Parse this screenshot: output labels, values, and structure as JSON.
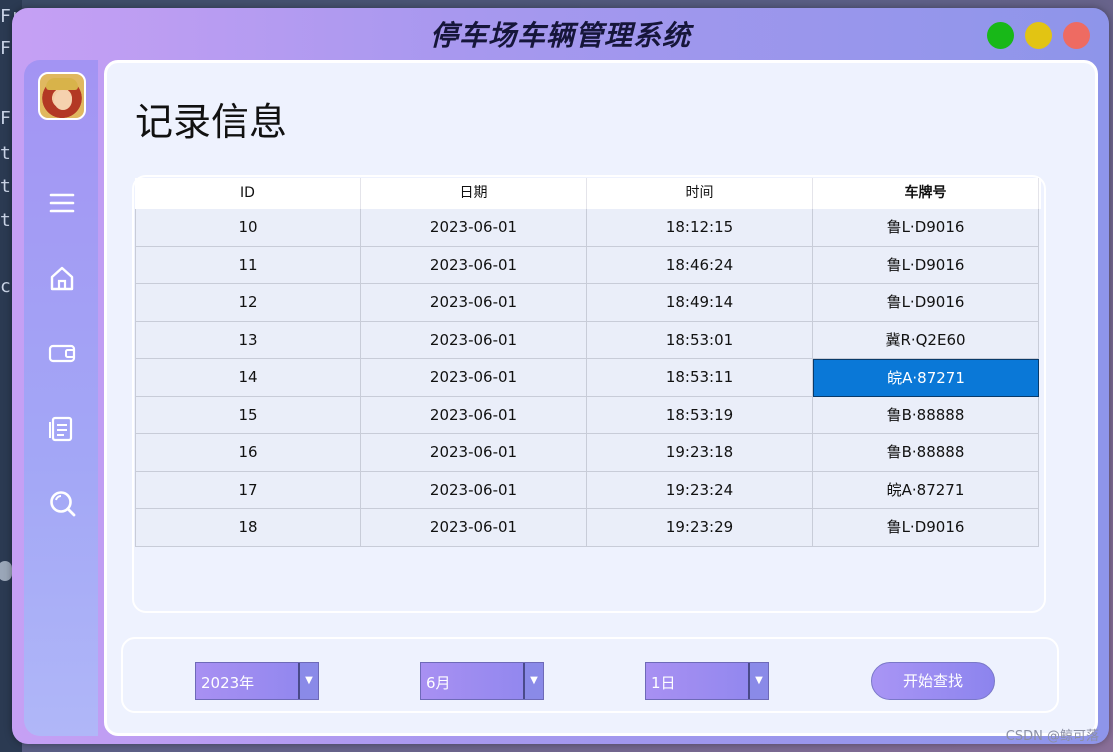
{
  "window": {
    "title": "停车场车辆管理系统"
  },
  "page": {
    "title": "记录信息"
  },
  "table": {
    "columns": [
      "ID",
      "日期",
      "时间",
      "车牌号"
    ],
    "rows": [
      [
        "10",
        "2023-06-01",
        "18:12:15",
        "鲁L·D9016"
      ],
      [
        "11",
        "2023-06-01",
        "18:46:24",
        "鲁L·D9016"
      ],
      [
        "12",
        "2023-06-01",
        "18:49:14",
        "鲁L·D9016"
      ],
      [
        "13",
        "2023-06-01",
        "18:53:01",
        "冀R·Q2E60"
      ],
      [
        "14",
        "2023-06-01",
        "18:53:11",
        "皖A·87271"
      ],
      [
        "15",
        "2023-06-01",
        "18:53:19",
        "鲁B·88888"
      ],
      [
        "16",
        "2023-06-01",
        "19:23:18",
        "鲁B·88888"
      ],
      [
        "17",
        "2023-06-01",
        "19:23:24",
        "皖A·87271"
      ],
      [
        "18",
        "2023-06-01",
        "19:23:29",
        "鲁L·D9016"
      ]
    ],
    "selected_cell": {
      "row": 4,
      "column": 3
    }
  },
  "filters": {
    "year": "2023年",
    "month": "6月",
    "day": "1日",
    "search_label": "开始查找"
  },
  "sidebar": {
    "icons": [
      "menu-icon",
      "home-icon",
      "wallet-icon",
      "document-icon",
      "search-icon"
    ]
  },
  "watermark": "CSDN @鲸可落",
  "background_code": [
    "Fr",
    "Fr",
    "Fr",
    "t.m",
    "t.m",
    "t.m",
    "cl"
  ],
  "colors": {
    "selected_cell": "#0a78d7",
    "window_btn_green": "#18b818",
    "window_btn_yellow": "#e2c413",
    "window_btn_red": "#ee6b62"
  }
}
